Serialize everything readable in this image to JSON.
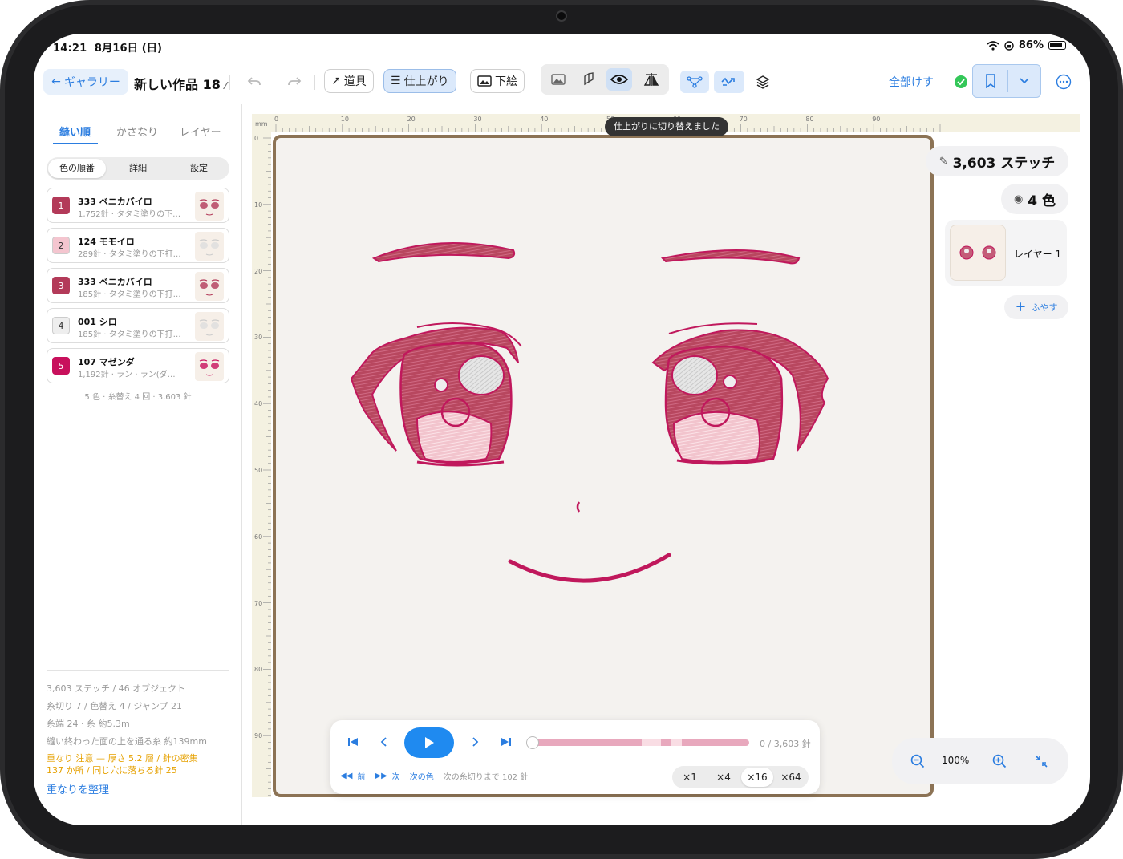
{
  "status": {
    "time": "14:21",
    "date": "8月16日 (日)",
    "battery": "86%"
  },
  "toolbar": {
    "back_label": "ギャラリー",
    "doc_title": "新しい作品 18",
    "tools_label": "道具",
    "finish_label": "仕上がり",
    "underlay_label": "下絵",
    "clear_all": "全部けす"
  },
  "left": {
    "tabs": [
      "縫い順",
      "かさなり",
      "レイヤー"
    ],
    "subtabs": [
      "色の順番",
      "詳細",
      "設定"
    ],
    "colors": [
      {
        "num": "1",
        "name": "333 ベニカバイロ",
        "sub": "1,752針 · タタミ塗りの下…",
        "color": "#b33a59"
      },
      {
        "num": "2",
        "name": "124 モモイロ",
        "sub": "289針 · タタミ塗りの下打…",
        "color": "#f4c5cf"
      },
      {
        "num": "3",
        "name": "333 ベニカバイロ",
        "sub": "185針 · タタミ塗りの下打…",
        "color": "#b33a59"
      },
      {
        "num": "4",
        "name": "001 シロ",
        "sub": "185針 · タタミ塗りの下打…",
        "color": "#eeeeee"
      },
      {
        "num": "5",
        "name": "107 マゼンダ",
        "sub": "1,192針 · ラン · ラン(ダ…",
        "color": "#c8105c"
      }
    ],
    "summary": "5 色 · 糸替え 4 回 · 3,603 針",
    "stats": [
      "3,603 ステッチ / 46 オブジェクト",
      "糸切り 7 / 色替え 4 / ジャンプ 21",
      "糸端 24 · 糸 約5.3m",
      "縫い終わった面の上を通る糸 約139mm"
    ],
    "warn1": "重なり 注意 — 厚さ 5.2 層 / 針の密集",
    "warn2": "137 か所 / 同じ穴に落ちる針 25",
    "organize": "重なりを整理"
  },
  "canvas": {
    "unit": "mm",
    "top_ticks": [
      "0",
      "10",
      "20",
      "30",
      "40",
      "50",
      "60",
      "70",
      "80",
      "90"
    ],
    "left_ticks": [
      "0",
      "10",
      "20",
      "30",
      "40",
      "50",
      "60",
      "70",
      "80",
      "90"
    ],
    "toast": "仕上がりに切り替えました",
    "thread_color": "#c0185c",
    "fill_color": "#b8475f",
    "pink_color": "#f2c4cd"
  },
  "player": {
    "count": "0 / 3,603 針",
    "prev": "前",
    "next": "次",
    "next_color": "次の色",
    "next_trim": "次の糸切りまで 102 針",
    "speeds": [
      "×1",
      "×4",
      "×16",
      "×64"
    ]
  },
  "right": {
    "stitches": "3,603 ステッチ",
    "colors": "4 色",
    "layer_name": "レイヤー 1",
    "add": "ふやす",
    "zoom": "100%"
  }
}
